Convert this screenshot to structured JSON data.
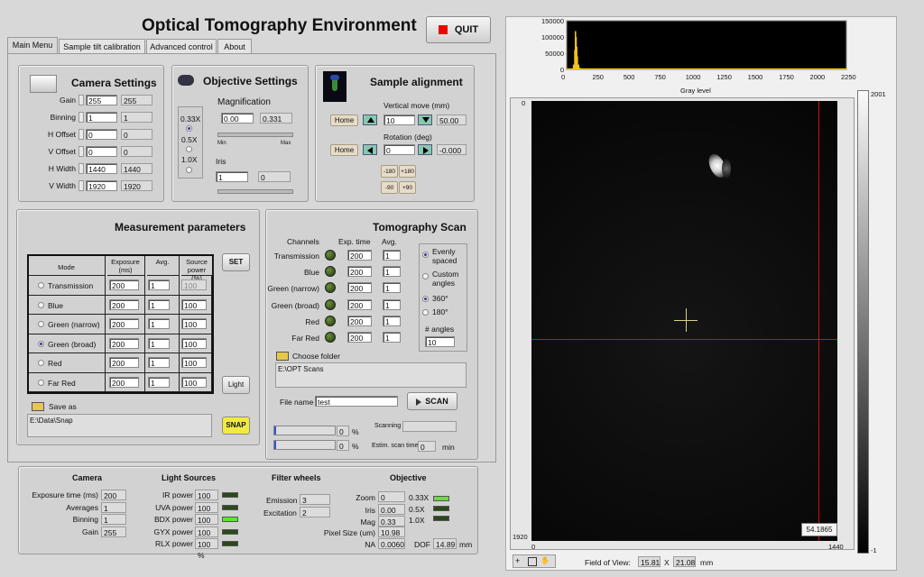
{
  "app": {
    "title": "Optical Tomography Environment",
    "quit_label": "QUIT"
  },
  "tabs": [
    "Main Menu",
    "Sample tilt calibration",
    "Advanced control",
    "About"
  ],
  "camera": {
    "title": "Camera Settings",
    "rows": [
      {
        "label": "Gain",
        "value": "255",
        "readback": "255"
      },
      {
        "label": "Binning",
        "value": "1",
        "readback": "1"
      },
      {
        "label": "H Offset",
        "value": "0",
        "readback": "0"
      },
      {
        "label": "V Offset",
        "value": "0",
        "readback": "0"
      },
      {
        "label": "H Width",
        "value": "1440",
        "readback": "1440"
      },
      {
        "label": "V Width",
        "value": "1920",
        "readback": "1920"
      }
    ]
  },
  "objective": {
    "title": "Objective Settings",
    "options": [
      "0.33X",
      "0.5X",
      "1.0X"
    ],
    "magnification_label": "Magnification",
    "magnification_value": "0.00",
    "magnification_readback": "0.331",
    "min_label": "Min",
    "max_label": "Max",
    "iris_label": "Iris",
    "iris_value": "1",
    "iris_readback": "0"
  },
  "alignment": {
    "title": "Sample alignment",
    "vertical_label": "Vertical move (mm)",
    "home_label": "Home",
    "vertical_value": "10",
    "vertical_readback": "50.00",
    "rotation_label": "Rotation (deg)",
    "rotation_value": "0",
    "rotation_readback": "-0.000",
    "rot_buttons": [
      "-180",
      "+180",
      "-90",
      "+90"
    ]
  },
  "measurement": {
    "title": "Measurement parameters",
    "headers": [
      "Mode",
      "Exposure (ms)",
      "Avg.",
      "Source power (%)"
    ],
    "rows": [
      {
        "mode": "Transmission",
        "exposure": "200",
        "avg": "1",
        "power": "100"
      },
      {
        "mode": "Blue",
        "exposure": "200",
        "avg": "1",
        "power": "100"
      },
      {
        "mode": "Green (narrow)",
        "exposure": "200",
        "avg": "1",
        "power": "100"
      },
      {
        "mode": "Green (broad)",
        "exposure": "200",
        "avg": "1",
        "power": "100"
      },
      {
        "mode": "Red",
        "exposure": "200",
        "avg": "1",
        "power": "100"
      },
      {
        "mode": "Far Red",
        "exposure": "200",
        "avg": "1",
        "power": "100"
      }
    ],
    "set_label": "SET",
    "light_label": "Light",
    "save_as_label": "Save as",
    "save_path": "E:\\Data\\Snap",
    "snap_label": "SNAP"
  },
  "tomo": {
    "title": "Tomography Scan",
    "headers": [
      "Channels",
      "Exp. time",
      "Avg."
    ],
    "rows": [
      {
        "channel": "Transmission",
        "exp": "200",
        "avg": "1"
      },
      {
        "channel": "Blue",
        "exp": "200",
        "avg": "1"
      },
      {
        "channel": "Green (narrow)",
        "exp": "200",
        "avg": "1"
      },
      {
        "channel": "Green (broad)",
        "exp": "200",
        "avg": "1"
      },
      {
        "channel": "Red",
        "exp": "200",
        "avg": "1"
      },
      {
        "channel": "Far Red",
        "exp": "200",
        "avg": "1"
      }
    ],
    "evenly_label": "Evenly spaced",
    "custom_label": "Custom angles",
    "deg360": "360°",
    "deg180": "180°",
    "angles_label": "# angles",
    "angles_value": "10",
    "choose_folder_label": "Choose folder",
    "folder_path": "E:\\OPT Scans",
    "file_name_label": "File name",
    "file_name": "test",
    "scan_label": "SCAN",
    "progress1": "0",
    "progress2": "0",
    "pct": "%",
    "scanning_label": "Scanning",
    "estim_label": "Estim. scan time",
    "estim_value": "0",
    "estim_unit": "min"
  },
  "status": {
    "camera_title": "Camera",
    "camera_rows": [
      {
        "label": "Exposure time (ms)",
        "value": "200"
      },
      {
        "label": "Averages",
        "value": "1"
      },
      {
        "label": "Binning",
        "value": "1"
      },
      {
        "label": "Gain",
        "value": "255"
      }
    ],
    "light_title": "Light Sources",
    "light_rows": [
      {
        "label": "IR  power",
        "value": "100 %",
        "on": false
      },
      {
        "label": "UVA power",
        "value": "100 %",
        "on": false
      },
      {
        "label": "BDX power",
        "value": "100 %",
        "on": true
      },
      {
        "label": "GYX power",
        "value": "100 %",
        "on": false
      },
      {
        "label": "RLX power",
        "value": "100 %",
        "on": false
      }
    ],
    "filter_title": "Filter wheels",
    "emission_label": "Emission",
    "emission_value": "3",
    "excitation_label": "Excitation",
    "excitation_value": "2",
    "objective_title": "Objective",
    "zoom_label": "Zoom",
    "zoom_value": "0",
    "iris_label": "Iris",
    "iris_value": "0.00",
    "mag_label": "Mag",
    "mag_value": "0.33",
    "obj_leds": [
      "0.33X",
      "0.5X",
      "1.0X"
    ],
    "pixel_label": "Pixel Size (um)",
    "pixel_value": "10.98",
    "na_label": "NA",
    "na_value": "0.0060",
    "dof_label": "DOF",
    "dof_value": "14.89",
    "dof_unit": "mm"
  },
  "histogram": {
    "xlabel": "Gray level",
    "xticks": [
      "0",
      "250",
      "500",
      "750",
      "1000",
      "1250",
      "1500",
      "1750",
      "2000",
      "2250"
    ],
    "yticks": [
      "150000",
      "100000",
      "50000",
      "0"
    ]
  },
  "image": {
    "y_top": "0",
    "y_bottom": "1920",
    "x_left": "0",
    "x_right": "1440",
    "cursor_value": "54.1865",
    "colorbar_max": "2001",
    "colorbar_min": "-1",
    "fov_label": "Field of View:",
    "fov_x": "15.81",
    "fov_sep": "X",
    "fov_y": "21.08",
    "fov_unit": "mm"
  }
}
